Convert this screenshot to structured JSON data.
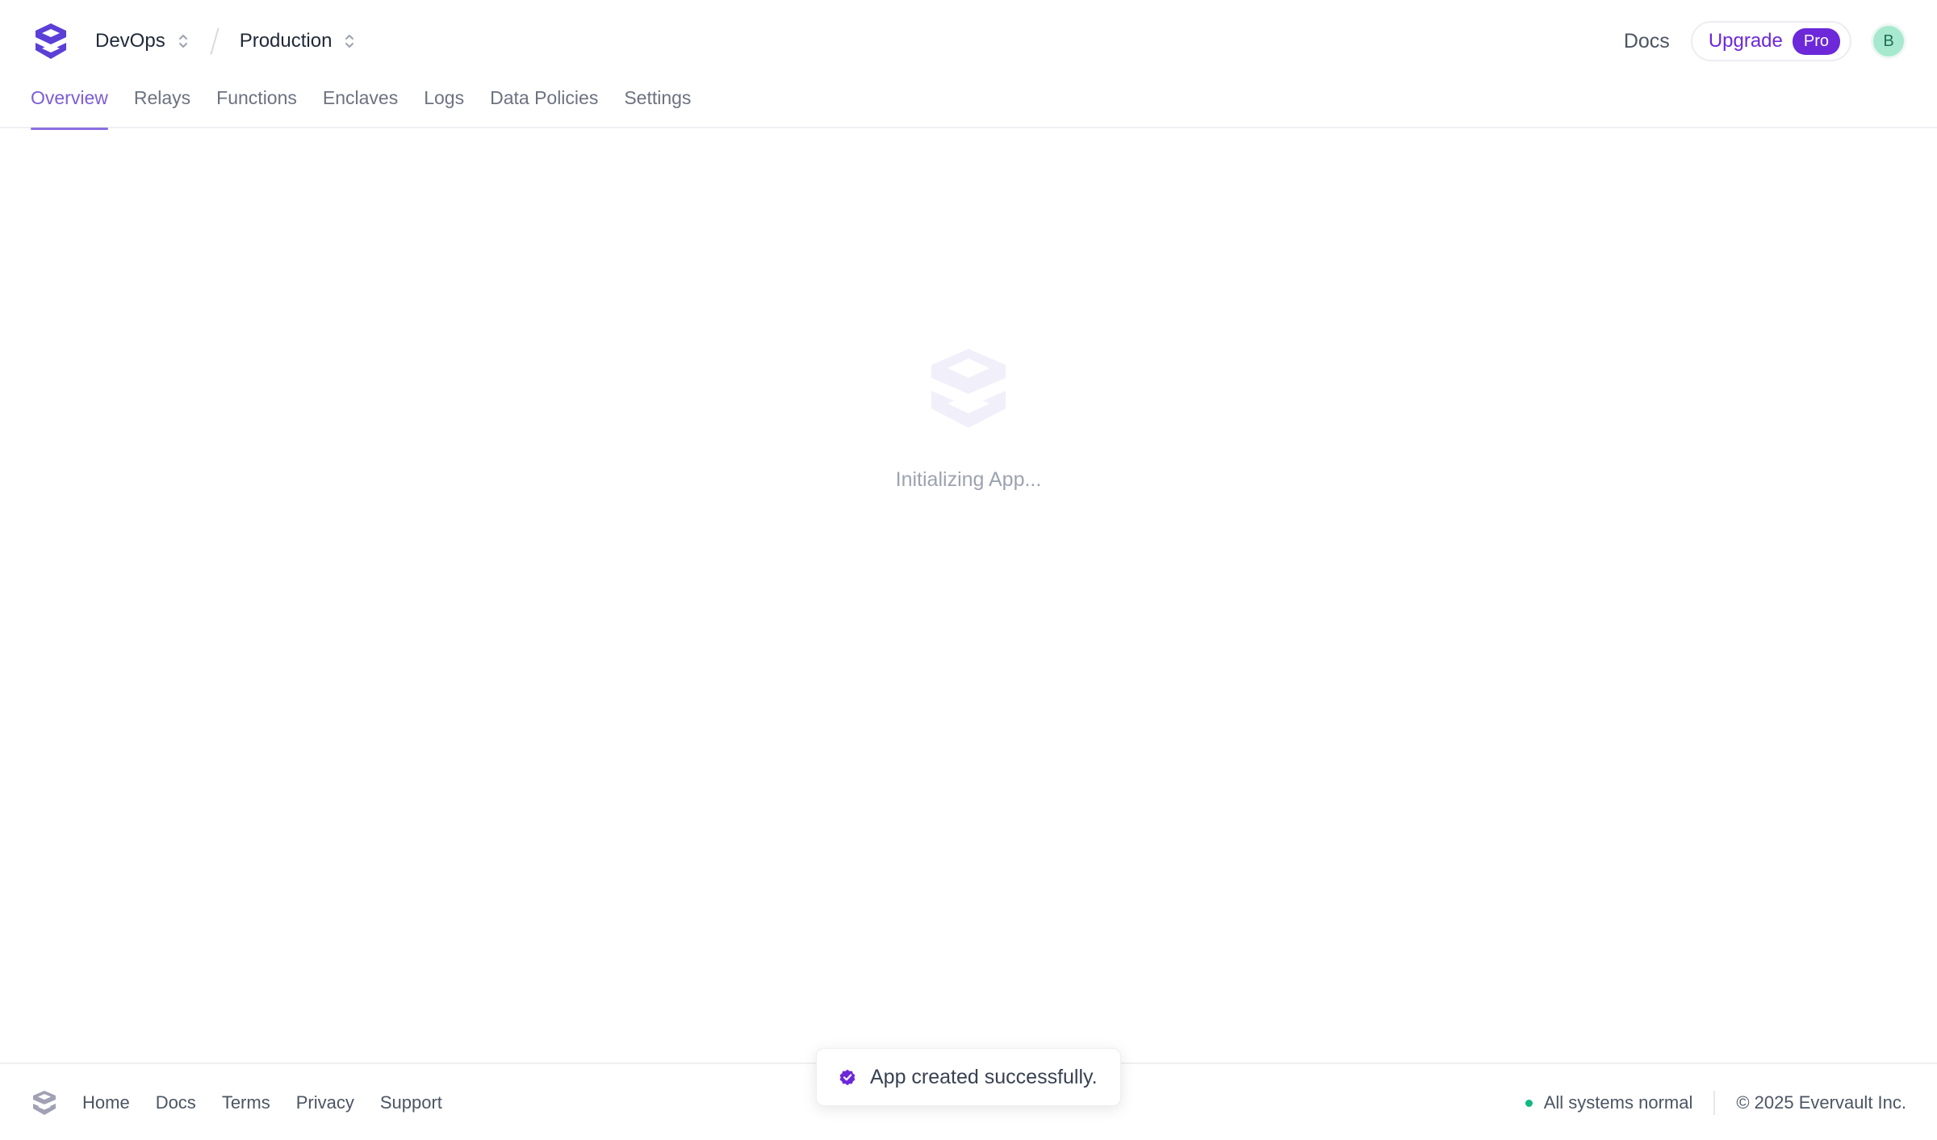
{
  "header": {
    "org_name": "DevOps",
    "app_name": "Production",
    "docs_label": "Docs",
    "upgrade_label": "Upgrade",
    "pro_badge": "Pro",
    "avatar_initial": "B"
  },
  "tabs": [
    {
      "label": "Overview",
      "active": true
    },
    {
      "label": "Relays",
      "active": false
    },
    {
      "label": "Functions",
      "active": false
    },
    {
      "label": "Enclaves",
      "active": false
    },
    {
      "label": "Logs",
      "active": false
    },
    {
      "label": "Data Policies",
      "active": false
    },
    {
      "label": "Settings",
      "active": false
    }
  ],
  "main": {
    "loading_text": "Initializing App..."
  },
  "toast": {
    "message": "App created successfully."
  },
  "footer": {
    "links": [
      "Home",
      "Docs",
      "Terms",
      "Privacy",
      "Support"
    ],
    "status": "All systems normal",
    "copyright": "© 2025 Evervault Inc."
  },
  "colors": {
    "brand": "#6d28d9",
    "tab_active": "#7c5cd6",
    "status_ok": "#10b981",
    "avatar_bg": "#a7e9cf"
  },
  "icons": {
    "logo": "evervault-logo-icon",
    "crumb_chevron": "chevron-up-down-icon",
    "toast": "check-badge-icon",
    "status": "status-dot-icon"
  }
}
